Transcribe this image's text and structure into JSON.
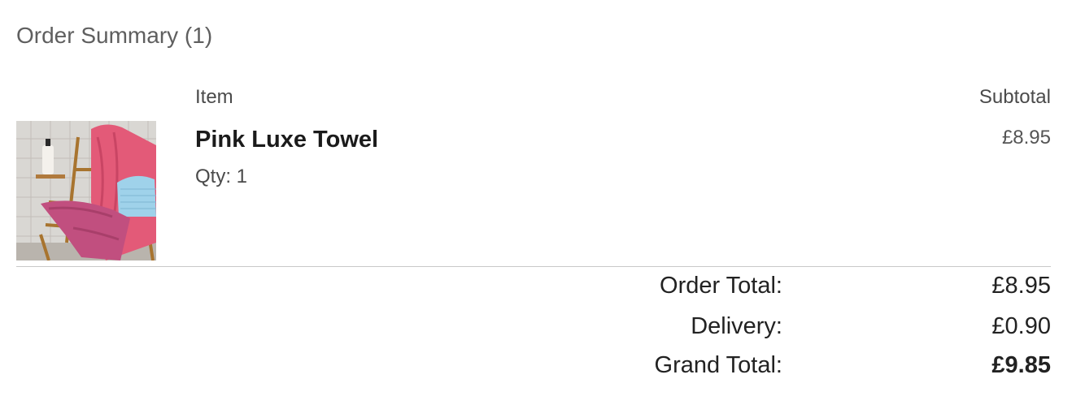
{
  "summary": {
    "title": "Order Summary (1)"
  },
  "table": {
    "headers": {
      "item": "Item",
      "subtotal": "Subtotal"
    },
    "rows": [
      {
        "name": "Pink Luxe Towel",
        "qty": "Qty: 1",
        "subtotal": "£8.95",
        "image": "pink-towel-thumbnail"
      }
    ]
  },
  "totals": {
    "order_total_label": "Order Total:",
    "order_total_value": "£8.95",
    "delivery_label": "Delivery:",
    "delivery_value": "£0.90",
    "grand_total_label": "Grand Total:",
    "grand_total_value": "£9.85"
  },
  "colors": {
    "text_primary": "#1f1f1f",
    "text_secondary": "#5f5f5f",
    "divider": "#c8c8c8",
    "towel_pink": "#e35a78"
  }
}
